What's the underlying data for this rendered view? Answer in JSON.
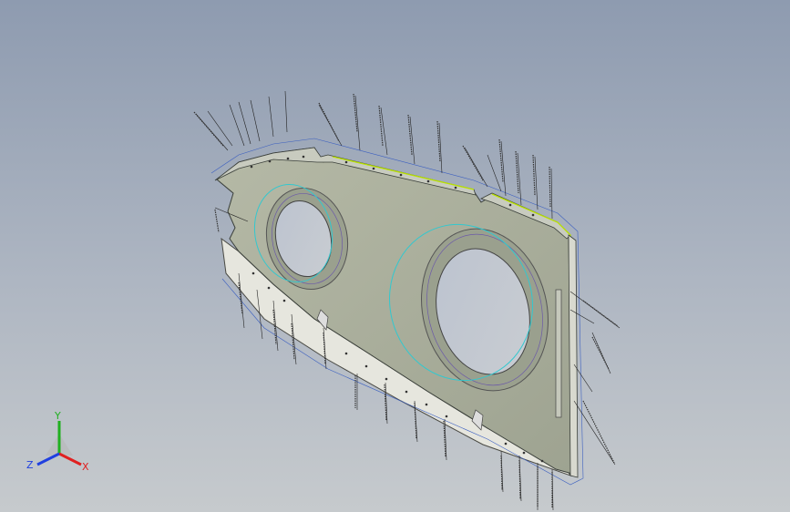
{
  "viewport": {
    "background_top": "#8e9bb0",
    "background_bottom": "#c6cacd"
  },
  "model": {
    "face_color": "#a9ad9a",
    "edge_color": "#3a3f3a",
    "flange_color": "#e8e8e0",
    "annotation_color": "#3b5fc0",
    "highlight_color": "#32c8cf",
    "sketch_color": "#6c5aa8",
    "selected_edge_color": "#b8e000"
  },
  "triad": {
    "x_label": "X",
    "y_label": "Y",
    "z_label": "Z",
    "x_color": "#e02020",
    "y_color": "#20b020",
    "z_color": "#2040e0"
  }
}
